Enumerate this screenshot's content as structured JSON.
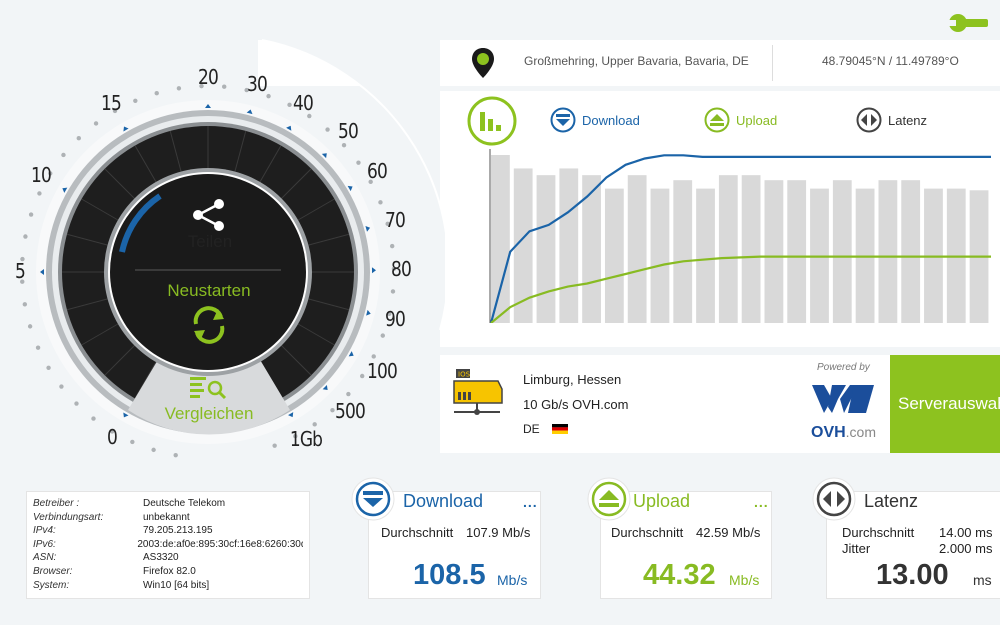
{
  "location": {
    "place": "Großmehring, Upper Bavaria, Bavaria, DE",
    "coords": "48.79045°N / 11.49789°O"
  },
  "legend": {
    "download": "Download",
    "upload": "Upload",
    "latency": "Latenz"
  },
  "gauge": {
    "ticks": [
      "0",
      "5",
      "10",
      "15",
      "20",
      "30",
      "40",
      "50",
      "60",
      "70",
      "80",
      "90",
      "100",
      "500",
      "1Gb"
    ],
    "share_label": "Teilen",
    "restart_label": "Neustarten",
    "compare_label": "Vergleichen"
  },
  "server": {
    "city": "Limburg, Hessen",
    "isp": "10 Gb/s OVH.com",
    "country": "DE",
    "powered_by": "Powered by",
    "brand": "OVH",
    "brand_suffix": ".com",
    "select_button": "Serverauswahl"
  },
  "info": {
    "rows": [
      {
        "k": "Betreiber :",
        "v": "Deutsche Telekom"
      },
      {
        "k": "Verbindungsart:",
        "v": "unbekannt"
      },
      {
        "k": "IPv4:",
        "v": "79.205.213.195"
      },
      {
        "k": "IPv6:",
        "v": "2003:de:af0e:895:30cf:16e8:6260:30d0"
      },
      {
        "k": "ASN:",
        "v": "AS3320"
      },
      {
        "k": "Browser:",
        "v": "Firefox 82.0"
      },
      {
        "k": "System:",
        "v": "Win10 [64 bits]"
      }
    ]
  },
  "results": {
    "download": {
      "title": "Download",
      "dots": "...",
      "avg_label": "Durchschnitt",
      "avg_value": "107.9 Mb/s",
      "value": "108.5",
      "unit": "Mb/s"
    },
    "upload": {
      "title": "Upload",
      "dots": "...",
      "avg_label": "Durchschnitt",
      "avg_value": "42.59 Mb/s",
      "value": "44.32",
      "unit": "Mb/s"
    },
    "latency": {
      "title": "Latenz",
      "avg_label": "Durchschnitt",
      "avg_value": "14.00 ms",
      "jitter_label": "Jitter",
      "jitter_value": "2.000 ms",
      "value": "13.00",
      "unit": "ms"
    }
  },
  "colors": {
    "download": "#1b64a8",
    "upload": "#88bb22",
    "accent_green": "#8dc21f"
  },
  "icons": [
    "wrench-icon",
    "location-pin-icon",
    "bar-chart-icon",
    "download-icon",
    "upload-icon",
    "latency-icon",
    "share-icon",
    "refresh-icon",
    "compare-icon",
    "server-icon",
    "flag-de-icon"
  ],
  "chart_data": {
    "type": "line",
    "series": [
      {
        "name": "Download",
        "values": [
          0,
          45,
          58,
          62,
          70,
          80,
          92,
          100,
          104,
          106,
          106,
          105,
          105,
          105,
          105,
          105,
          105,
          105,
          105,
          105,
          105,
          105,
          105,
          105,
          105,
          105,
          105
        ]
      },
      {
        "name": "Upload",
        "values": [
          0,
          10,
          16,
          20,
          23,
          25,
          28,
          31,
          34,
          37,
          39,
          40,
          41,
          41.5,
          42,
          42,
          42,
          42,
          42,
          42,
          42,
          42,
          42,
          42,
          42,
          42,
          42
        ]
      }
    ],
    "latency_bars": [
      100,
      92,
      88,
      92,
      88,
      80,
      88,
      80,
      85,
      80,
      88,
      88,
      85,
      85,
      80,
      85,
      80,
      85,
      85,
      80,
      80,
      79
    ],
    "ylim": [
      0,
      110
    ]
  }
}
